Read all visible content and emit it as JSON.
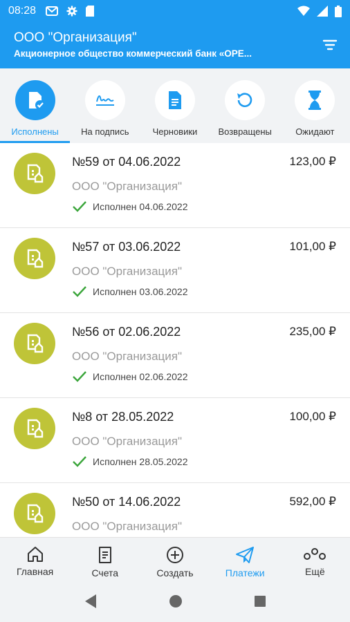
{
  "status_bar": {
    "time": "08:28"
  },
  "header": {
    "title": "ООО \"Организация\"",
    "subtitle": "Акционерное общество коммерческий банк «ОРЕ..."
  },
  "tabs": [
    {
      "label": "Исполнены",
      "icon": "document-check-icon",
      "active": true
    },
    {
      "label": "На подпись",
      "icon": "signature-icon",
      "active": false
    },
    {
      "label": "Черновики",
      "icon": "draft-document-icon",
      "active": false
    },
    {
      "label": "Возвращены",
      "icon": "return-arrow-icon",
      "active": false
    },
    {
      "label": "Ожидают",
      "icon": "hourglass-icon",
      "active": false
    }
  ],
  "payments": [
    {
      "title": "№59 от 04.06.2022",
      "amount": "123,00 ₽",
      "org": "ООО \"Организация\"",
      "status": "Исполнен 04.06.2022"
    },
    {
      "title": "№57 от 03.06.2022",
      "amount": "101,00 ₽",
      "org": "ООО \"Организация\"",
      "status": "Исполнен 03.06.2022"
    },
    {
      "title": "№56 от 02.06.2022",
      "amount": "235,00 ₽",
      "org": "ООО \"Организация\"",
      "status": "Исполнен 02.06.2022"
    },
    {
      "title": "№8 от 28.05.2022",
      "amount": "100,00 ₽",
      "org": "ООО \"Организация\"",
      "status": "Исполнен 28.05.2022"
    },
    {
      "title": "№50 от 14.06.2022",
      "amount": "592,00 ₽",
      "org": "ООО \"Организация\"",
      "status": ""
    }
  ],
  "bottom_nav": [
    {
      "label": "Главная",
      "icon": "home-icon",
      "active": false
    },
    {
      "label": "Счета",
      "icon": "accounts-icon",
      "active": false
    },
    {
      "label": "Создать",
      "icon": "create-plus-icon",
      "active": false
    },
    {
      "label": "Платежи",
      "icon": "payments-paper-plane-icon",
      "active": true
    },
    {
      "label": "Ещё",
      "icon": "more-icon",
      "active": false
    }
  ],
  "colors": {
    "primary": "#1e9bf0",
    "avatar": "#bfc438",
    "check": "#3aa53a",
    "muted": "#9a9a9a"
  }
}
